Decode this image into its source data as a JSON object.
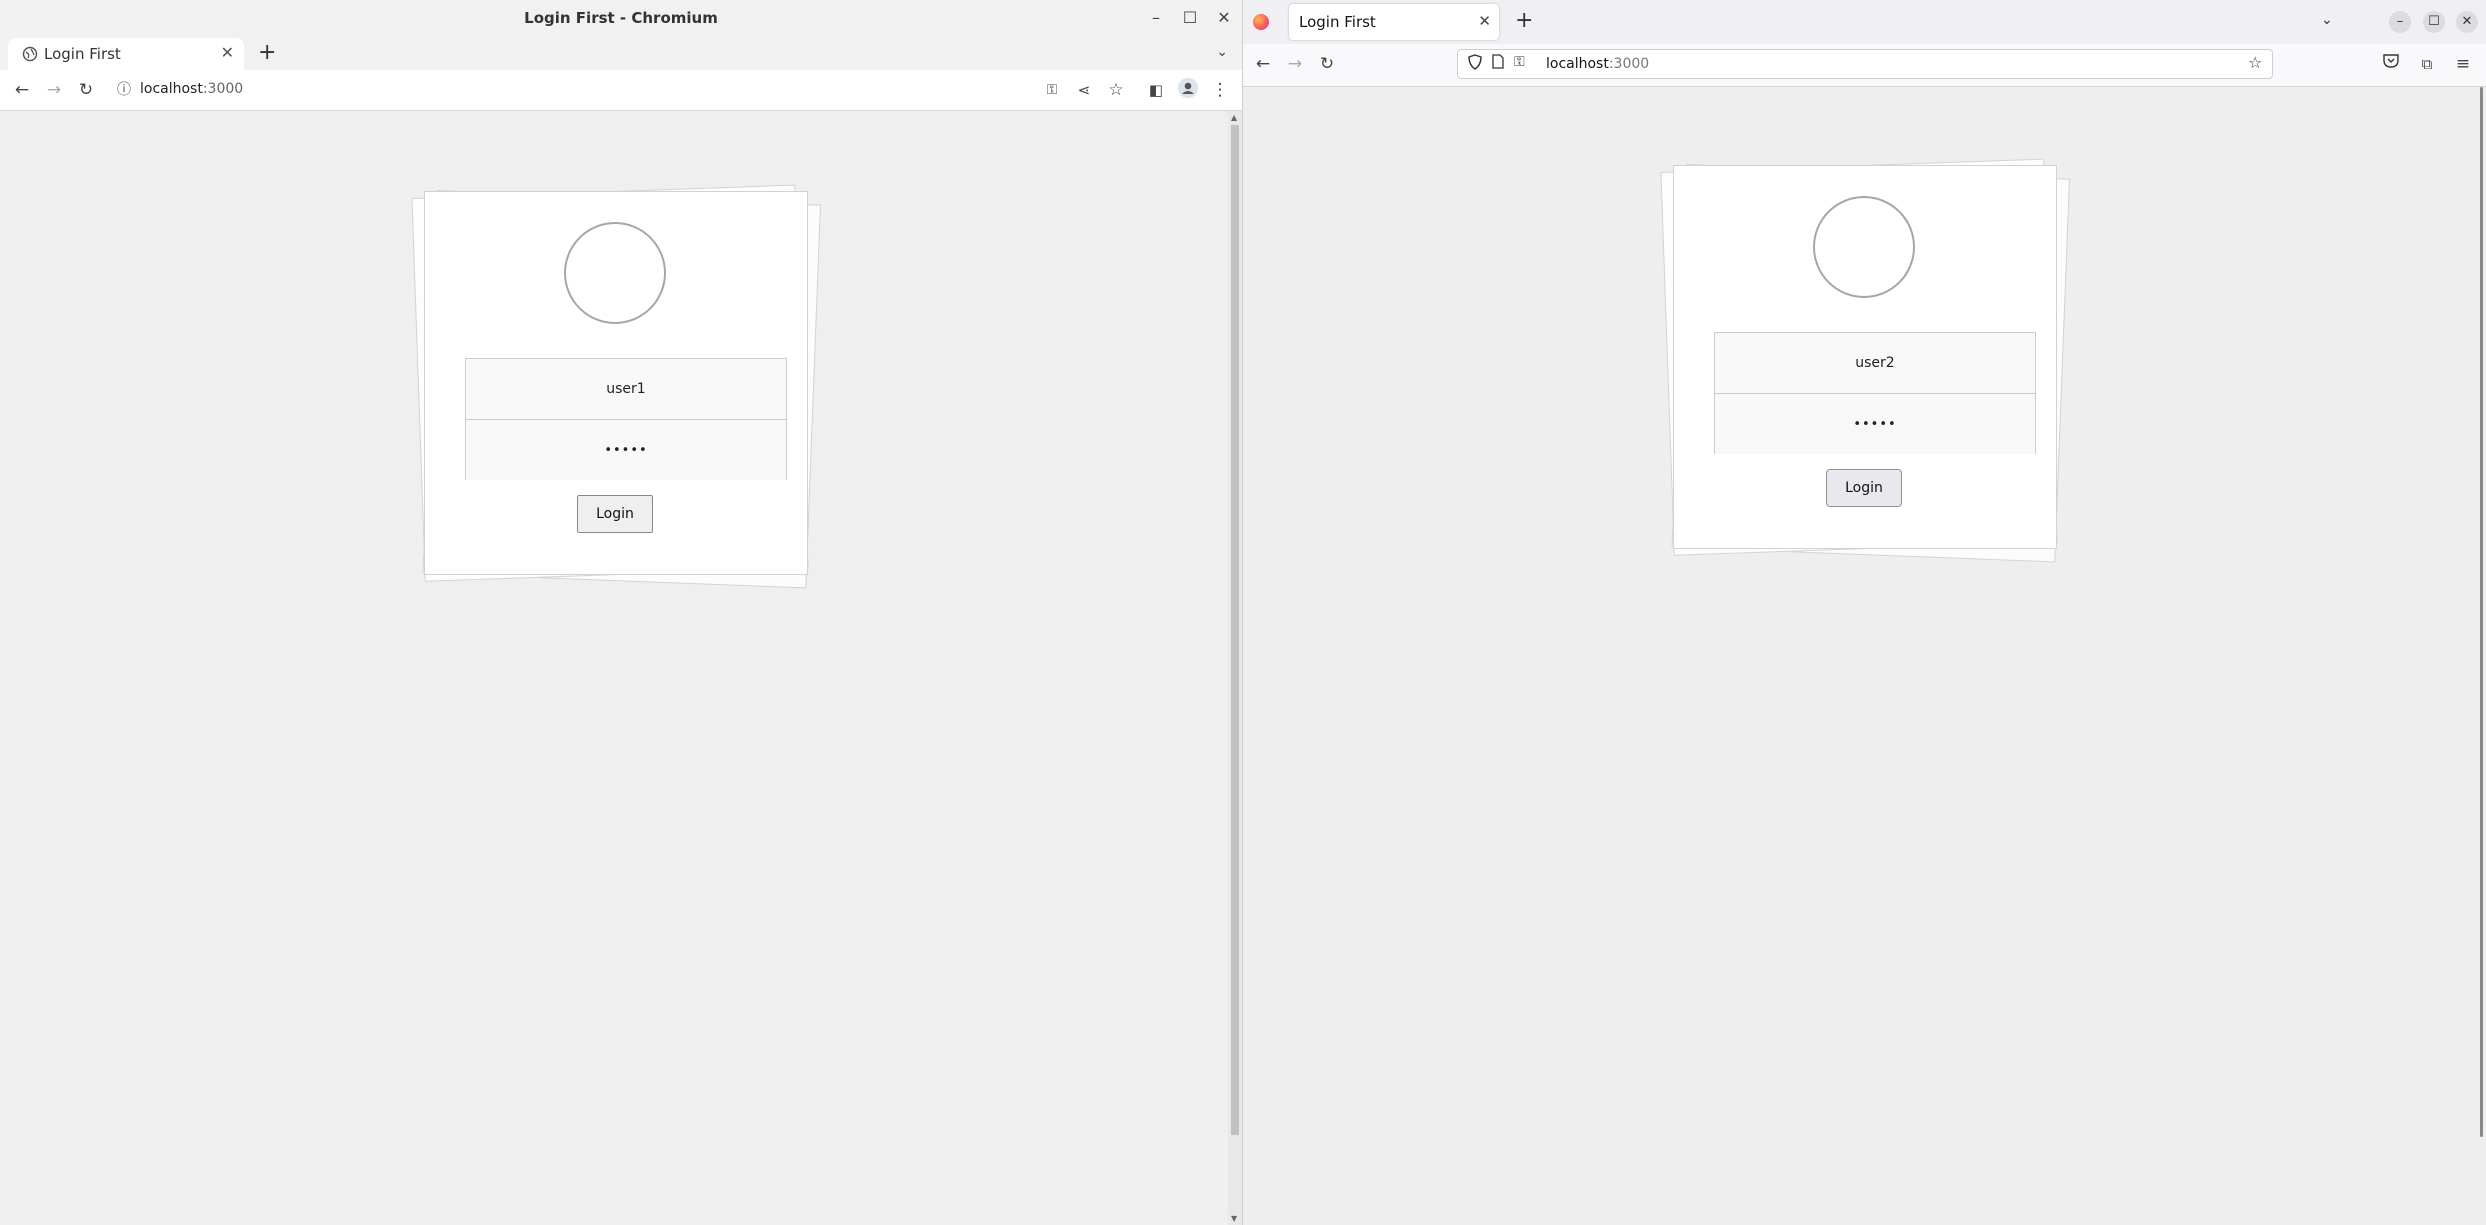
{
  "chromium": {
    "window_title": "Login First - Chromium",
    "tab_title": "Login First",
    "url_host": "localhost",
    "url_port": ":3000",
    "login": {
      "username": "user1",
      "password": "•••••",
      "button_label": "Login"
    }
  },
  "firefox": {
    "tab_title": "Login First",
    "url_host": "localhost",
    "url_port": ":3000",
    "login": {
      "username": "user2",
      "password": "•••••",
      "button_label": "Login"
    }
  }
}
